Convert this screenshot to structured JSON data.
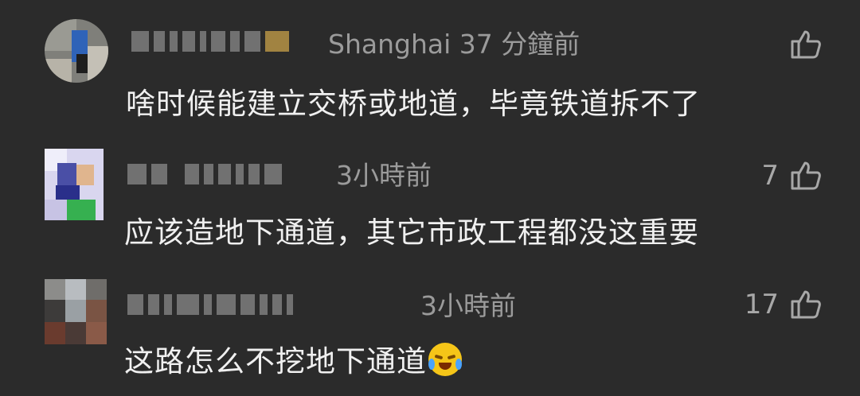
{
  "comments": [
    {
      "meta": "Shanghai 37 分鐘前",
      "text": "啥时候能建立交桥或地道，毕竟铁道拆不了",
      "likes": "",
      "like_icon": "thumbs-up-icon"
    },
    {
      "meta": "3小時前",
      "text": "应该造地下通道，其它市政工程都没这重要",
      "likes": "7",
      "like_icon": "thumbs-up-icon"
    },
    {
      "meta": "3小時前",
      "text": "这路怎么不挖地下通道",
      "likes": "17",
      "like_icon": "thumbs-up-icon",
      "emoji": "crying-laughing-face"
    }
  ],
  "colors": {
    "background": "#2b2b2b",
    "text": "#f0f0f0",
    "meta": "#9b9b9b"
  }
}
